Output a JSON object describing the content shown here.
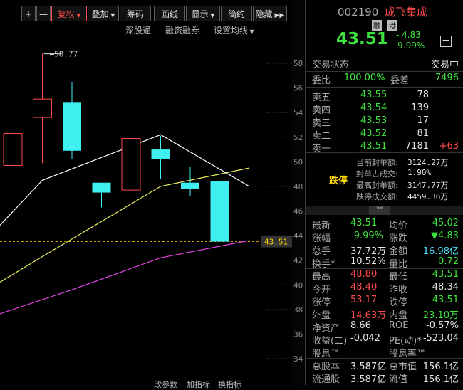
{
  "toolbar": {
    "buttons": [
      "+",
      "—",
      "复权",
      "叠加",
      "筹码",
      "画线",
      "显示",
      "简约",
      "隐藏"
    ],
    "sub_links": [
      "深股通",
      "融资融券",
      "设置均线"
    ]
  },
  "chart_data": {
    "type": "candlestick",
    "y_ticks": [
      "58.00",
      "56.00",
      "54.00",
      "52.00",
      "50.00",
      "48.00",
      "46.00",
      "44.00",
      "42.00",
      "40.00",
      "38.00",
      "36.00",
      "34.00"
    ],
    "ylim": [
      33.2,
      60.1
    ],
    "candles": [
      {
        "open": 52.3,
        "close": 49.7,
        "high": 52.3,
        "low": 49.7,
        "up": true
      },
      {
        "open": 53.6,
        "close": 55.1,
        "high": 58.77,
        "low": 49.9,
        "up": true
      },
      {
        "open": 50.9,
        "close": 54.8,
        "high": 56.5,
        "low": 50.2,
        "up": false
      },
      {
        "open": 48.3,
        "close": 47.5,
        "high": 48.3,
        "low": 46.3,
        "up": false
      },
      {
        "open": 51.9,
        "close": 47.7,
        "high": 51.9,
        "low": 47.7,
        "up": true
      },
      {
        "open": 51.0,
        "close": 50.2,
        "high": 52.1,
        "low": 48.6,
        "up": false
      },
      {
        "open": 48.3,
        "close": 47.8,
        "high": 49.6,
        "low": 47.2,
        "up": false
      },
      {
        "open": 48.4,
        "close": 43.51,
        "high": 48.4,
        "low": 43.51,
        "up": false
      }
    ],
    "ma_white": [
      [
        -1,
        43.4
      ],
      [
        1,
        48.5
      ],
      [
        5,
        52.2
      ],
      [
        8,
        48.0
      ]
    ],
    "ma_yellow": [
      [
        -1,
        39.4
      ],
      [
        1,
        42.3
      ],
      [
        5,
        48.0
      ],
      [
        8,
        49.5
      ]
    ],
    "ma_magenta": [
      [
        -1,
        37.2
      ],
      [
        2,
        39.6
      ],
      [
        5,
        42.2
      ],
      [
        8,
        43.6
      ]
    ],
    "high_marker": "58.77",
    "last_price": "43.51"
  },
  "bottom_tabs": [
    "改参数",
    "加指标",
    "换指标"
  ],
  "stock": {
    "code": "002190",
    "name": "成飞集成",
    "tags": [
      "融",
      "港"
    ],
    "price": "43.51",
    "change": "- 4.83",
    "change_pct": "- 9.99%",
    "trade_status_label": "交易状态",
    "trade_status": "交易中"
  },
  "commission": {
    "ratio_label": "委比",
    "ratio": "-100.00%",
    "diff_label": "委差",
    "diff": "-7496"
  },
  "orderbook": [
    {
      "label": "卖五",
      "price": "43.55",
      "vol": "78",
      "chg": ""
    },
    {
      "label": "卖四",
      "price": "43.54",
      "vol": "139",
      "chg": ""
    },
    {
      "label": "卖三",
      "price": "43.53",
      "vol": "17",
      "chg": ""
    },
    {
      "label": "卖二",
      "price": "43.52",
      "vol": "81",
      "chg": ""
    },
    {
      "label": "卖一",
      "price": "43.51",
      "vol": "7181",
      "chg": "+63"
    }
  ],
  "limit_info": {
    "badge": "跌停",
    "lines": [
      {
        "label": "当前封单额:",
        "value": "3124.27万"
      },
      {
        "label": "封单占成交:",
        "value": "1.90%"
      },
      {
        "label": "最高封单额:",
        "value": "3147.77万"
      },
      {
        "label": "跌停成交额:",
        "value": "4459.36万"
      }
    ]
  },
  "stats": [
    {
      "l1": "最新",
      "v1": "43.51",
      "c1": "green",
      "l2": "均价",
      "v2": "45.02",
      "c2": "green"
    },
    {
      "l1": "涨幅",
      "v1": "-9.99%",
      "c1": "green",
      "l2": "涨跌",
      "v2": "▼4.83",
      "c2": "green"
    },
    {
      "l1": "总手",
      "v1": "37.72万",
      "c1": "white",
      "l2": "金额",
      "v2": "16.98亿",
      "c2": "cyan"
    },
    {
      "l1": "换手*",
      "v1": "10.52%",
      "c1": "white",
      "l2": "量比",
      "v2": "0.72",
      "c2": "green"
    },
    {
      "l1": "最高",
      "v1": "48.80",
      "c1": "red",
      "l2": "最低",
      "v2": "43.51",
      "c2": "green"
    },
    {
      "l1": "今开",
      "v1": "48.40",
      "c1": "red",
      "l2": "昨收",
      "v2": "48.34",
      "c2": "white"
    },
    {
      "l1": "涨停",
      "v1": "53.17",
      "c1": "red",
      "l2": "跌停",
      "v2": "43.51",
      "c2": "green"
    },
    {
      "l1": "外盘",
      "v1": "14.63万",
      "c1": "red",
      "l2": "内盘",
      "v2": "23.10万",
      "c2": "green"
    },
    {
      "l1": "净资产",
      "v1": "8.66",
      "c1": "white",
      "l2": "ROE",
      "v2": "-0.57%",
      "c2": "white"
    },
    {
      "l1": "收益(二)",
      "v1": "-0.042",
      "c1": "white",
      "l2": "PE(动)*",
      "v2": "-523.04",
      "c2": "white"
    },
    {
      "l1": "股息™",
      "v1": "",
      "c1": "white",
      "l2": "股息率™",
      "v2": "",
      "c2": "white"
    },
    {
      "l1": "总股本",
      "v1": "3.587亿",
      "c1": "white",
      "l2": "总市值",
      "v2": "156.1亿",
      "c2": "white"
    },
    {
      "l1": "流通股",
      "v1": "3.587亿",
      "c1": "white",
      "l2": "流值",
      "v2": "156.1亿",
      "c2": "white"
    }
  ]
}
